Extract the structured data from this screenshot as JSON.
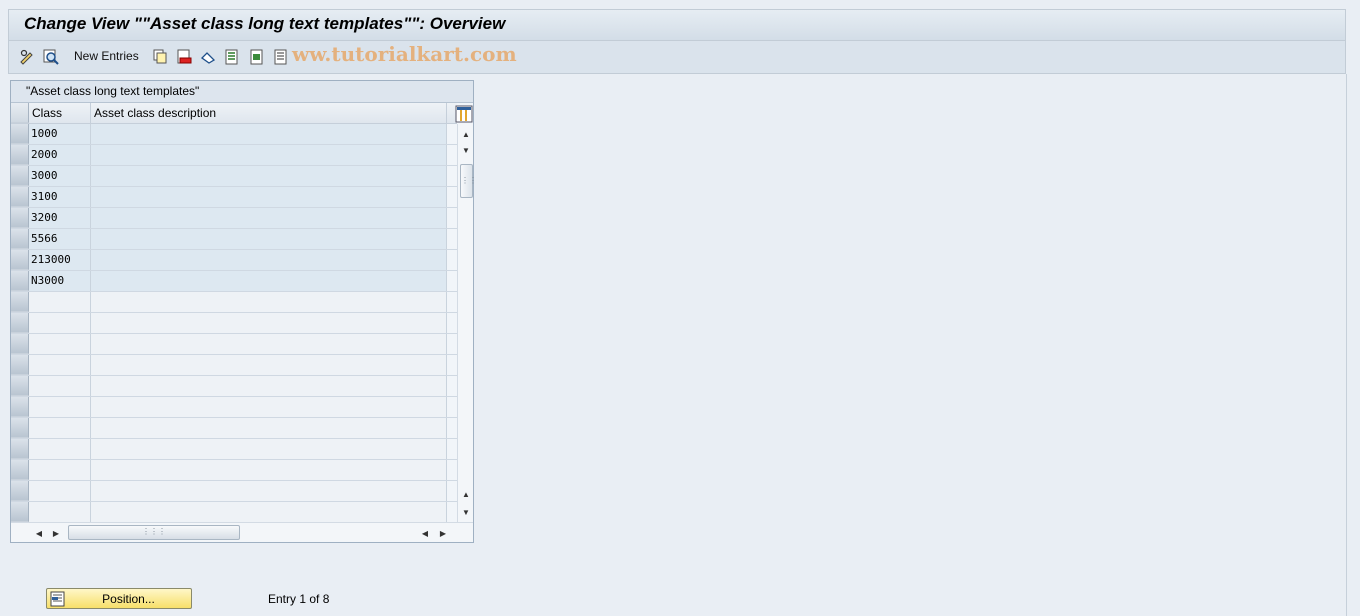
{
  "title": "Change View \"\"Asset class long text templates\"\": Overview",
  "toolbar": {
    "icons": [
      "edit-glasses-icon",
      "search-icon",
      "copy-icon",
      "delete-icon",
      "undo-icon",
      "select-all-icon",
      "select-block-icon",
      "deselect-icon"
    ],
    "new_entries_label": "New Entries",
    "watermark": "ww.tutorialkart.com"
  },
  "table": {
    "caption": "\"Asset class long text templates\"",
    "columns": [
      "Class",
      "Asset class description"
    ],
    "rows": [
      {
        "class": "1000",
        "description": ""
      },
      {
        "class": "2000",
        "description": ""
      },
      {
        "class": "3000",
        "description": ""
      },
      {
        "class": "3100",
        "description": ""
      },
      {
        "class": "3200",
        "description": ""
      },
      {
        "class": "5566",
        "description": ""
      },
      {
        "class": "213000",
        "description": ""
      },
      {
        "class": "N3000",
        "description": ""
      }
    ],
    "empty_rows": 11
  },
  "footer": {
    "position_button_label": "Position...",
    "entry_info": "Entry 1 of 8"
  },
  "colors": {
    "background": "#e9eef4",
    "filled_row": "#dde8f1",
    "button_yellow": "#f7df6a"
  }
}
